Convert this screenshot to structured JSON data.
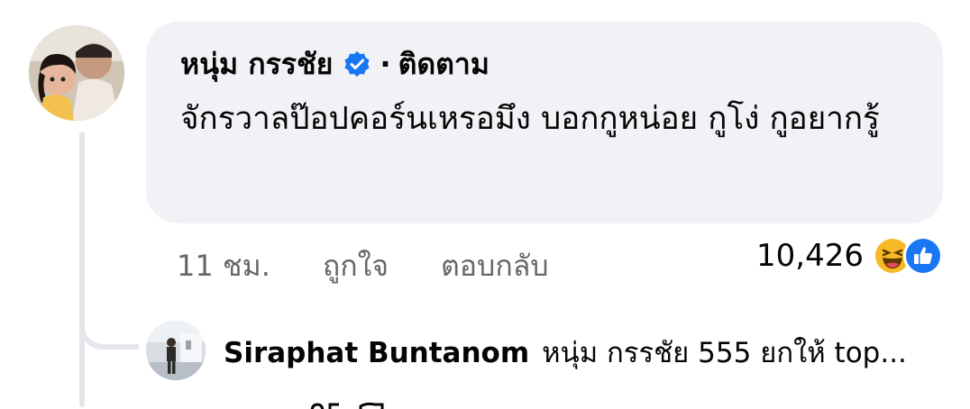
{
  "comment": {
    "author": "หนุ่ม กรรชัย",
    "follow_label": "ติดตาม",
    "separator": "·",
    "text": "จักรวาลป๊อปคอร์นเหรอมึง บอกกูหน่อย กูโง่ กูอยากรู้",
    "time": "11 ชม.",
    "like_label": "ถูกใจ",
    "reply_label": "ตอบกลับ",
    "reaction_count": "10,426",
    "reaction_icons": [
      "haha-icon",
      "like-icon"
    ]
  },
  "reply": {
    "author": "Siraphat Buntanom",
    "preview": "หนุ่ม กรรชัย 555 ยกให้ top..."
  },
  "colors": {
    "bubble": "#f0f2f5",
    "meta_text": "#65676b",
    "verified": "#1877f2",
    "like": "#1877f2",
    "haha": "#f7b928"
  }
}
